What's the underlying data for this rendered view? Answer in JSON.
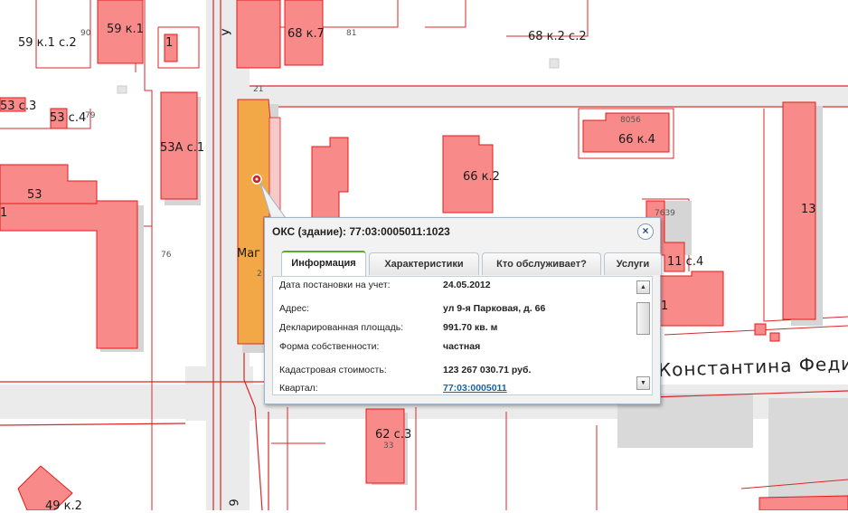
{
  "map": {
    "street_label": "Константина Федина",
    "building_labels": [
      "59 к.1 с.2",
      "90",
      "59 к.1",
      "1",
      "68 к.7",
      "81",
      "68 к.2 с.2",
      "53 с.3",
      "53 с.4",
      "79",
      "53А с.1",
      "21",
      "8056",
      "66 к.4",
      "66 к.2",
      "13",
      "7639",
      "11 с.4",
      "1",
      "53",
      "1",
      "76",
      "Маг",
      "2",
      "62 с.3",
      "33",
      "49 к.2",
      "У",
      "9"
    ]
  },
  "popup": {
    "title": "ОКС (здание): 77:03:0005011:1023",
    "close_symbol": "×",
    "tabs": [
      "Информация",
      "Характеристики",
      "Кто обслуживает?",
      "Услуги"
    ],
    "active_tab": "Информация",
    "fields": [
      {
        "label": "Дата постановки на учет:",
        "value": "24.05.2012"
      },
      {
        "label": "Адрес:",
        "value": "ул 9-я Парковая, д. 66"
      },
      {
        "label": "Декларированная площадь:",
        "value": "991.70 кв. м"
      },
      {
        "label": "Форма собственности:",
        "value": "частная"
      },
      {
        "label": "Кадастровая стоимость:",
        "value": "123 267 030.71 руб."
      },
      {
        "label": "Квартал:",
        "value": "77:03:0005011"
      }
    ],
    "scroll_up": "▲",
    "scroll_down": "▼"
  },
  "colors": {
    "building_fill": "#f98a8a",
    "building_stroke": "#e41b1b",
    "selected_fill": "#f2a846",
    "parcel_stroke": "#d9272a",
    "road": "#ebebeb",
    "shadow": "#d9d9d9",
    "tab_accent": "#5fa82e"
  }
}
